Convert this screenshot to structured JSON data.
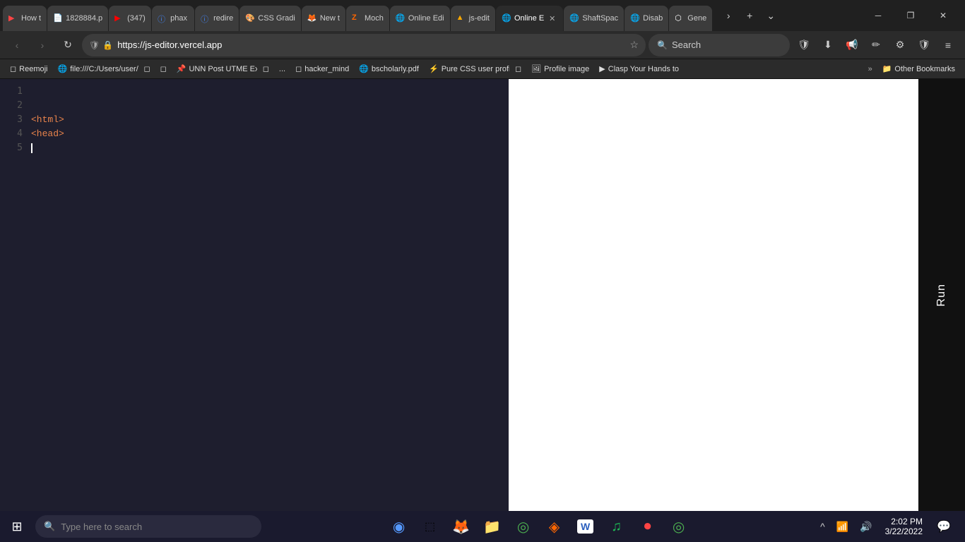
{
  "browser": {
    "tabs": [
      {
        "id": "tab1",
        "favicon": "▶",
        "favicon_color": "#ff4444",
        "label": "How t",
        "active": false
      },
      {
        "id": "tab2",
        "favicon": "📄",
        "favicon_color": "#888",
        "label": "1828884.p",
        "active": false
      },
      {
        "id": "tab3",
        "favicon": "▶",
        "favicon_color": "#ff0000",
        "label": "(347)",
        "active": false
      },
      {
        "id": "tab4",
        "favicon": "ⓘ",
        "favicon_color": "#4488ff",
        "label": "phax",
        "active": false
      },
      {
        "id": "tab5",
        "favicon": "ⓘ",
        "favicon_color": "#4488ff",
        "label": "redire",
        "active": false
      },
      {
        "id": "tab6",
        "favicon": "🎨",
        "favicon_color": "#888",
        "label": "CSS Gradi",
        "active": false
      },
      {
        "id": "tab7",
        "favicon": "🦊",
        "favicon_color": "#ff6600",
        "label": "New t",
        "active": false
      },
      {
        "id": "tab8",
        "favicon": "Z",
        "favicon_color": "#ff6600",
        "label": "Moch",
        "active": false
      },
      {
        "id": "tab9",
        "favicon": "◻",
        "favicon_color": "#888",
        "label": "Online Edi",
        "active": false
      },
      {
        "id": "tab10",
        "favicon": "▲",
        "favicon_color": "#ffaa00",
        "label": "js-edit",
        "active": false
      },
      {
        "id": "tab11",
        "favicon": "◻",
        "favicon_color": "#888",
        "label": "Online E",
        "active": true,
        "close": "✕"
      },
      {
        "id": "tab12",
        "favicon": "◻",
        "favicon_color": "#888",
        "label": "ShaftSpac",
        "active": false
      },
      {
        "id": "tab13",
        "favicon": "◻",
        "favicon_color": "#888",
        "label": "Disab",
        "active": false
      },
      {
        "id": "tab14",
        "favicon": "⬡",
        "favicon_color": "#333",
        "label": "Gene",
        "active": false
      }
    ],
    "tab_actions": {
      "more": "›",
      "new_tab": "+",
      "tab_list": "⌄"
    },
    "window_controls": {
      "minimize": "─",
      "maximize": "❐",
      "close": "✕"
    },
    "address": "https://js-editor.vercel.app",
    "search_placeholder": "Search",
    "toolbar_icons": [
      "shield",
      "lock",
      "star",
      "download",
      "speaker",
      "pen",
      "gear",
      "shield2",
      "menu"
    ],
    "bookmarks": [
      {
        "id": "bm1",
        "icon": "◻",
        "label": "Reemoji"
      },
      {
        "id": "bm2",
        "icon": "🌐",
        "label": "file:///C:/Users/user/D..."
      },
      {
        "id": "bm3",
        "icon": "◻",
        "label": ""
      },
      {
        "id": "bm4",
        "icon": "◻",
        "label": ""
      },
      {
        "id": "bm5",
        "icon": "📌",
        "label": "UNN Post UTME Exam..."
      },
      {
        "id": "bm6",
        "icon": "◻",
        "label": ""
      },
      {
        "id": "bm7",
        "icon": "◻",
        "label": "..."
      },
      {
        "id": "bm8",
        "icon": "◻",
        "label": "hacker_mind"
      },
      {
        "id": "bm9",
        "icon": "🌐",
        "label": "bscholarly.pdf"
      },
      {
        "id": "bm10",
        "icon": "⚡",
        "label": "Pure CSS user profile s..."
      },
      {
        "id": "bm11",
        "icon": "◻",
        "label": ""
      },
      {
        "id": "bm12",
        "icon": "🖼",
        "label": "Profile image"
      },
      {
        "id": "bm13",
        "icon": "▶",
        "label": "Clasp Your Hands to S..."
      }
    ],
    "bookmarks_overflow": "»",
    "other_bookmarks_label": "Other Bookmarks"
  },
  "editor": {
    "code_lines": [
      {
        "num": "",
        "content": "",
        "type": "empty"
      },
      {
        "num": "",
        "content": "",
        "type": "empty"
      },
      {
        "num": "",
        "content": "<html>",
        "type": "tag"
      },
      {
        "num": "",
        "content": "<head>",
        "type": "tag"
      },
      {
        "num": "",
        "content": "",
        "type": "cursor"
      }
    ]
  },
  "run_button": {
    "label": "Run"
  },
  "taskbar": {
    "start_icon": "⊞",
    "search_placeholder": "Type here to search",
    "search_icon": "🔍",
    "center_apps": [
      {
        "id": "cortana",
        "icon": "◉",
        "label": "Cortana"
      },
      {
        "id": "taskview",
        "icon": "⬚",
        "label": "Task View"
      },
      {
        "id": "firefox",
        "icon": "🦊",
        "label": "Firefox"
      },
      {
        "id": "files",
        "icon": "📁",
        "label": "File Explorer"
      },
      {
        "id": "chrome",
        "icon": "◎",
        "label": "Chrome"
      },
      {
        "id": "sublime",
        "icon": "◈",
        "label": "Sublime Text"
      },
      {
        "id": "word",
        "icon": "W",
        "label": "Word"
      },
      {
        "id": "spotify",
        "icon": "♫",
        "label": "Spotify"
      },
      {
        "id": "record",
        "icon": "⏺",
        "label": "Recorder"
      },
      {
        "id": "browser2",
        "icon": "◎",
        "label": "Browser"
      }
    ],
    "sys_icons": [
      "^",
      "🔊",
      "📶"
    ],
    "time": "2:02 PM",
    "date": "3/22/2022",
    "notification_icon": "💬"
  }
}
